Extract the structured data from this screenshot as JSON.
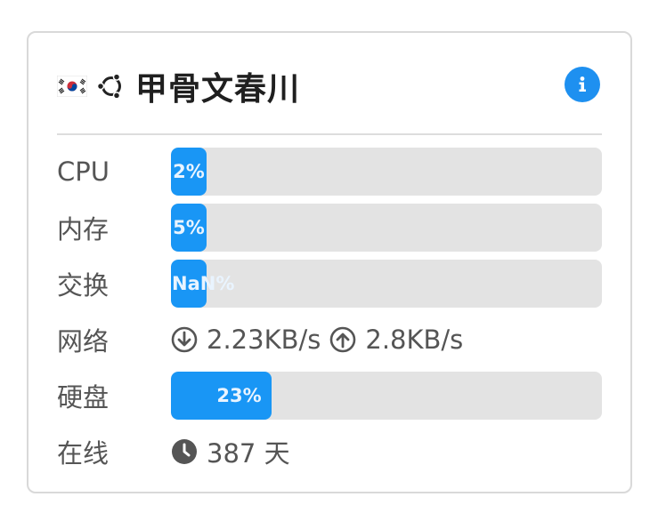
{
  "header": {
    "title": "甲骨文春川",
    "flag_icon": "south-korea-flag-icon",
    "os_icon": "ubuntu-icon",
    "info_icon": "info-icon",
    "accent_color": "#1996f5"
  },
  "stats": {
    "cpu": {
      "label": "CPU",
      "percent": 2,
      "text": "2%"
    },
    "memory": {
      "label": "内存",
      "percent": 5,
      "text": "5%"
    },
    "swap": {
      "label": "交换",
      "percent": 0,
      "text": "NaN%"
    },
    "network": {
      "label": "网络",
      "down": "2.23KB/s",
      "up": "2.8KB/s"
    },
    "disk": {
      "label": "硬盘",
      "percent": 23,
      "text": "23%"
    },
    "uptime": {
      "label": "在线",
      "value": "387 天"
    }
  }
}
